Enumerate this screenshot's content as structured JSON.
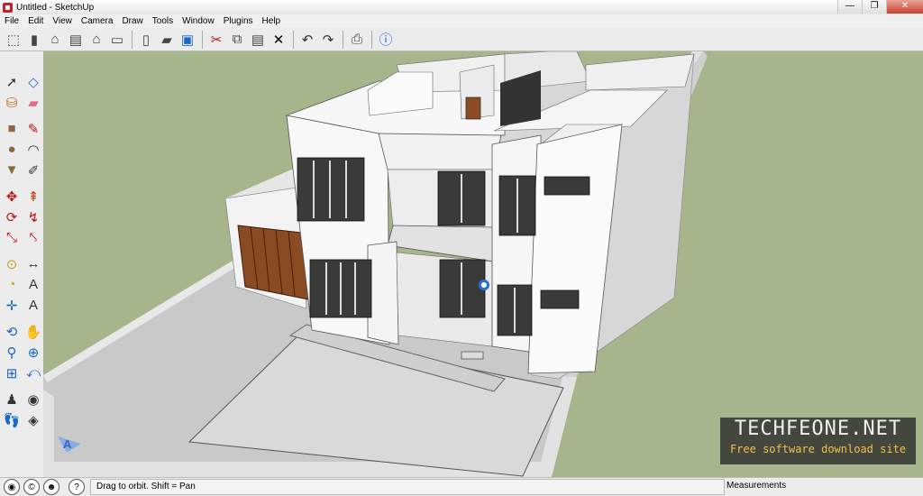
{
  "window": {
    "title": "Untitled - SketchUp",
    "minimize": "—",
    "restore": "❐",
    "close": "✕"
  },
  "menu": [
    "File",
    "Edit",
    "View",
    "Camera",
    "Draw",
    "Tools",
    "Window",
    "Plugins",
    "Help"
  ],
  "toolbar": [
    {
      "icon": "iso-view-icon"
    },
    {
      "icon": "front-view-icon"
    },
    {
      "icon": "home-view-icon"
    },
    {
      "icon": "side-view-icon"
    },
    {
      "icon": "house-outline-icon"
    },
    {
      "icon": "top-view-icon"
    },
    {
      "sep": true
    },
    {
      "icon": "new-file-icon"
    },
    {
      "icon": "open-folder-icon"
    },
    {
      "icon": "save-icon"
    },
    {
      "sep": true
    },
    {
      "icon": "cut-icon"
    },
    {
      "icon": "copy-icon"
    },
    {
      "icon": "paste-icon"
    },
    {
      "icon": "erase-x-icon"
    },
    {
      "sep": true
    },
    {
      "icon": "undo-icon"
    },
    {
      "icon": "redo-icon"
    },
    {
      "sep": true
    },
    {
      "icon": "print-icon"
    },
    {
      "sep": true
    },
    {
      "icon": "model-info-icon"
    }
  ],
  "palette": [
    [
      "select-arrow-icon",
      "make-component-icon"
    ],
    [
      "paint-bucket-icon",
      "eraser-icon"
    ],
    "gap",
    [
      "rectangle-icon",
      "line-pencil-icon"
    ],
    [
      "circle-icon",
      "arc-icon"
    ],
    [
      "polygon-icon",
      "freehand-icon"
    ],
    "gap",
    [
      "move-icon",
      "push-pull-icon"
    ],
    [
      "rotate-icon",
      "follow-me-icon"
    ],
    [
      "scale-icon",
      "offset-icon"
    ],
    "gap",
    [
      "tape-measure-icon",
      "dimension-icon"
    ],
    [
      "protractor-icon",
      "text-label-icon"
    ],
    [
      "axes-icon",
      "3d-text-icon"
    ],
    "gap",
    [
      "orbit-icon",
      "pan-hand-icon"
    ],
    [
      "zoom-icon",
      "zoom-window-icon"
    ],
    [
      "zoom-extents-icon",
      "previous-view-icon"
    ],
    "gap",
    [
      "position-camera-icon",
      "look-around-icon"
    ],
    [
      "walk-icon",
      "section-plane-icon"
    ]
  ],
  "status": {
    "icons": [
      "geo-location-icon",
      "credits-icon",
      "user-icon"
    ],
    "help_icon": "help-icon",
    "help_symbol": "?",
    "message": "Drag to orbit.  Shift = Pan",
    "measurements_label": "Measurements"
  },
  "watermark": {
    "title": "TECHFEONE.NET",
    "subtitle": "Free software download site"
  },
  "colors": {
    "ground": "#a6b58c",
    "walls": "#f6f6f6",
    "wood": "#8a4a22",
    "accent_blue": "#1c63c7"
  }
}
